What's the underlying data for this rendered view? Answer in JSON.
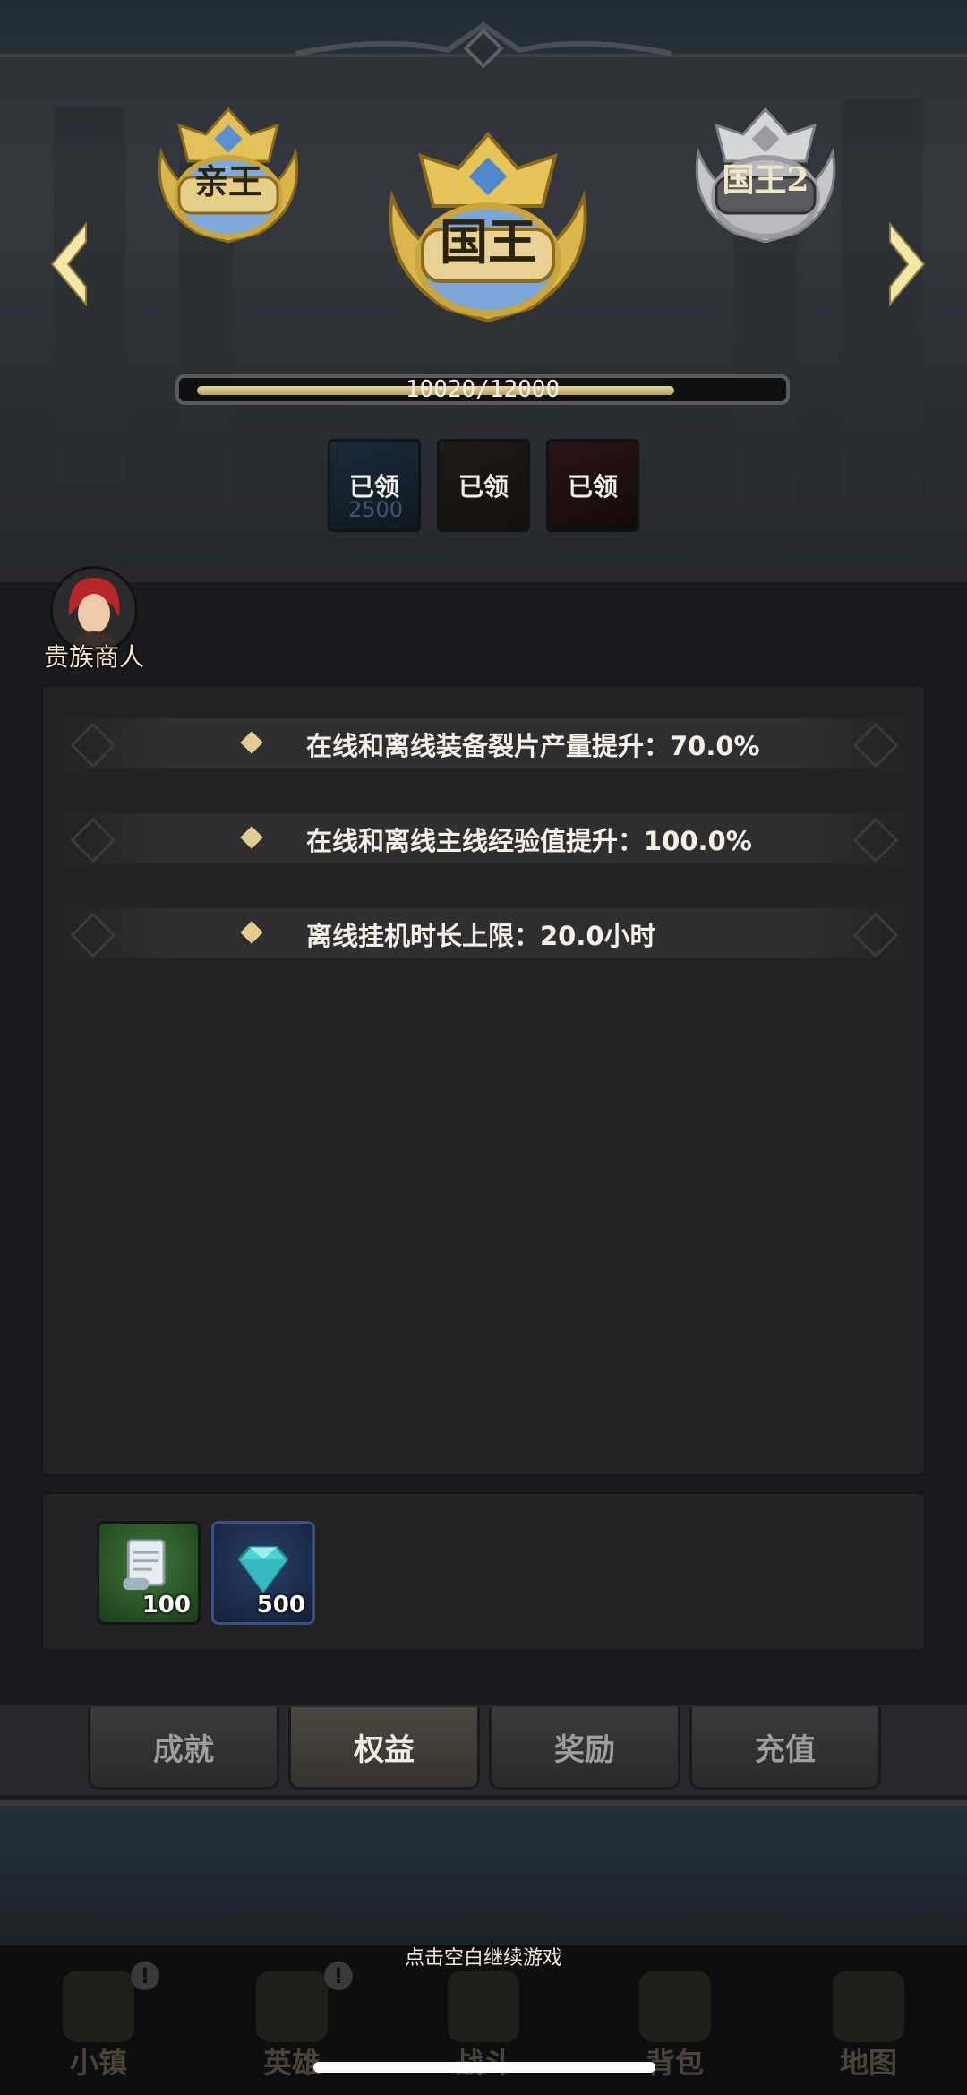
{
  "header": {
    "left_rank": "亲王",
    "current_rank": "国王",
    "right_rank": "国王2"
  },
  "progress": {
    "text": "10020/12000",
    "current": 10020,
    "max": 12000
  },
  "level_rewards": [
    {
      "label": "已领",
      "ghost": "2500"
    },
    {
      "label": "已领",
      "ghost": ""
    },
    {
      "label": "已领",
      "ghost": ""
    }
  ],
  "merchant": {
    "label": "贵族商人"
  },
  "benefits": [
    "在线和离线装备裂片产量提升：70.0%",
    "在线和离线主线经验值提升：100.0%",
    "离线挂机时长上限：20.0小时"
  ],
  "items": [
    {
      "icon": "scroll-icon",
      "count": "100"
    },
    {
      "icon": "diamond-icon",
      "count": "500"
    }
  ],
  "tabs": [
    {
      "label": "成就",
      "active": false
    },
    {
      "label": "权益",
      "active": true
    },
    {
      "label": "奖励",
      "active": false
    },
    {
      "label": "充值",
      "active": false
    }
  ],
  "continue_hint": "点击空白继续游戏",
  "nav": [
    {
      "label": "小镇",
      "alert": true
    },
    {
      "label": "英雄",
      "alert": true
    },
    {
      "label": "战斗",
      "alert": false
    },
    {
      "label": "背包",
      "alert": false
    },
    {
      "label": "地图",
      "alert": false
    }
  ],
  "colors": {
    "gold": "#e0cc92",
    "panel": "#232325",
    "background": "#1a1b1f"
  }
}
